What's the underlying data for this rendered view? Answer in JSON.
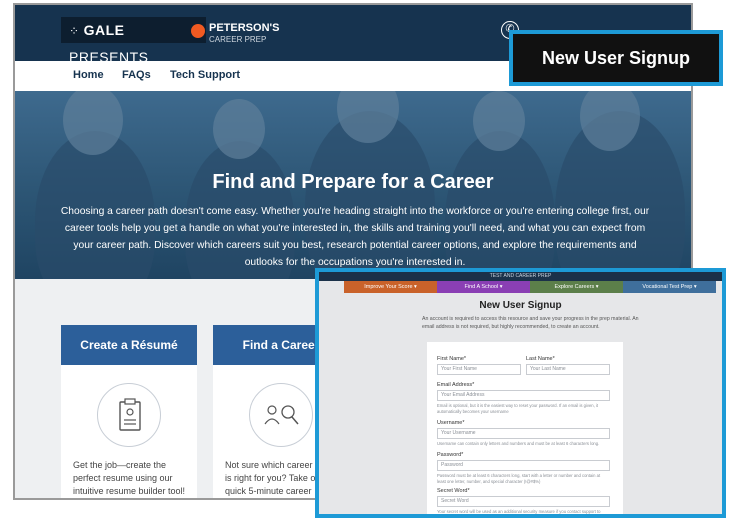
{
  "header": {
    "gale_bold": "GALE",
    "gale_thin": "PRESENTS",
    "peterson_title": "PETERSON'S",
    "peterson_sub": "CAREER PREP"
  },
  "nav": [
    "Home",
    "FAQs",
    "Tech Support"
  ],
  "callout": {
    "label": "New User Signup"
  },
  "hero": {
    "title": "Find and Prepare for a Career",
    "text": "Choosing a career path doesn't come easy. Whether you're heading straight into the workforce or you're entering college first, our career tools help you get a handle on what you're interested in, the skills and training you'll need, and what you can expect from your career path. Discover which careers suit you best, research potential career options, and explore the requirements and outlooks for the occupations you're interested in."
  },
  "cards": [
    {
      "title": "Create a Résumé",
      "text": "Get the job—create the perfect resume using our intuitive resume builder tool! Quickly choose a template"
    },
    {
      "title": "Find a Career",
      "text": "Not sure which career path is right for you? Take our quick 5-minute career survey and learn about"
    }
  ],
  "signup": {
    "top_label": "TEST AND CAREER PREP",
    "tabs": [
      {
        "label": "Improve Your Score ▾",
        "color": "#c9622a"
      },
      {
        "label": "Find A School ▾",
        "color": "#8a3fb4"
      },
      {
        "label": "Explore Careers ▾",
        "color": "#5c7f4a"
      },
      {
        "label": "Vocational Test Prep ▾",
        "color": "#3f6f9c"
      }
    ],
    "title": "New User Signup",
    "intro": "An account is required to access this resource and save your progress in the prep material. An email address is not required, but highly recommended, to create an account.",
    "first_name_label": "First Name*",
    "first_name_placeholder": "Your First Name",
    "last_name_label": "Last Name*",
    "last_name_placeholder": "Your Last Name",
    "email_label": "Email Address*",
    "email_placeholder": "Your Email Address",
    "email_help": "Email is optional, but it is the easiest way to reset your password. If an email is given, it automatically becomes your username",
    "username_label": "Username*",
    "username_placeholder": "Your Username",
    "username_help": "Username can contain only letters and numbers and must be at least 6 characters long.",
    "password_label": "Password*",
    "password_placeholder": "Password",
    "password_help": "Password must be at least 6 characters long, start with a letter or number and contain at least one letter, number, and special character (!@#$%)",
    "secret_label": "Secret Word*",
    "secret_placeholder": "Secret Word",
    "secret_help": "Your secret word will be used as an additional security measure if you contact support to reset your password or delete your account. It should be a single word, with only upper and"
  }
}
